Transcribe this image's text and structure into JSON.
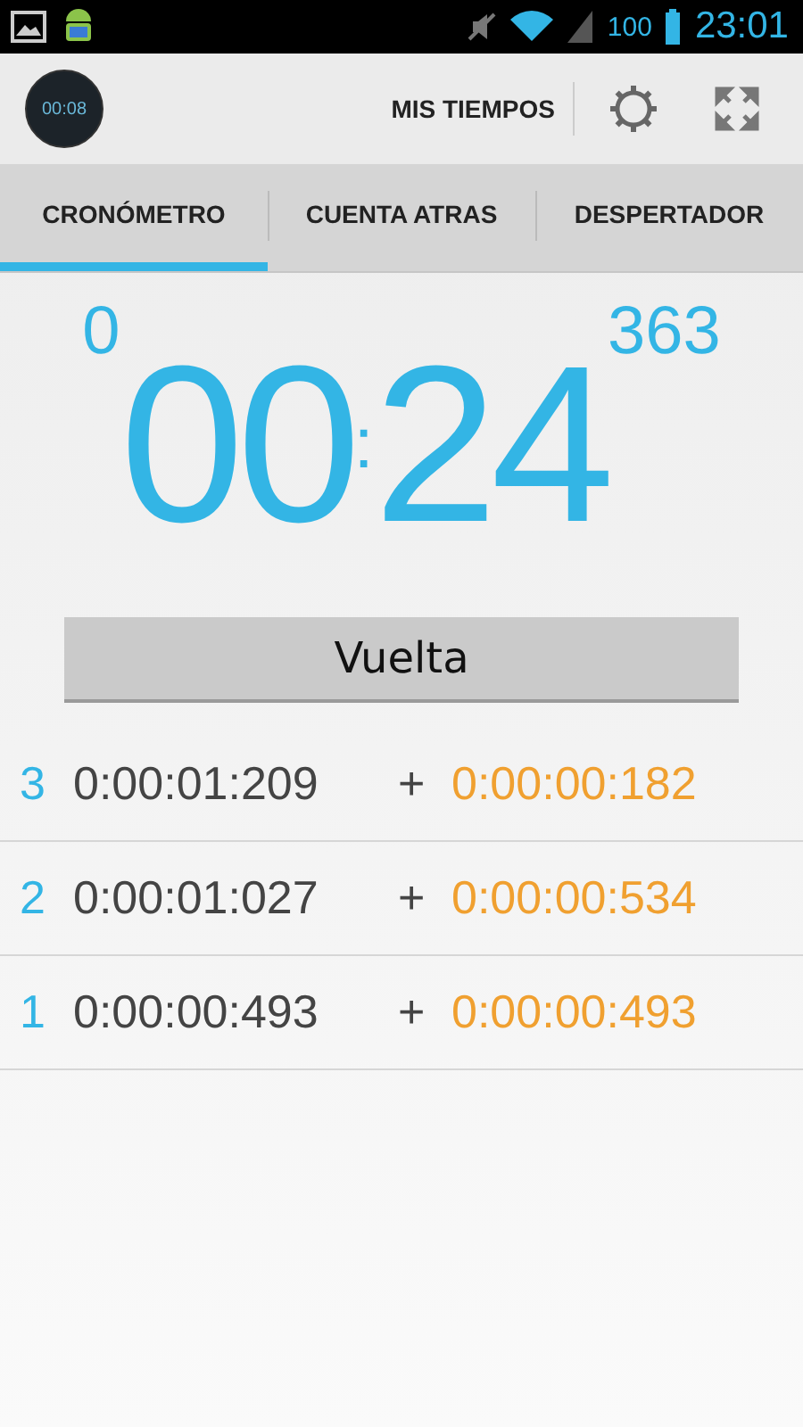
{
  "status_bar": {
    "battery": "100",
    "time": "23:01"
  },
  "action_bar": {
    "logo_text": "00:08",
    "title": "MIS TIEMPOS"
  },
  "tabs": [
    {
      "label": "CRONÓMETRO",
      "selected": true
    },
    {
      "label": "CUENTA ATRAS",
      "selected": false
    },
    {
      "label": "DESPERTADOR",
      "selected": false
    }
  ],
  "clock": {
    "hours": "0",
    "minutes": "00",
    "separator": ":",
    "seconds": "24",
    "milliseconds": "363"
  },
  "lap_button": "Vuelta",
  "laps": [
    {
      "number": "3",
      "total": "0:00:01:209",
      "plus": "+",
      "split": "0:00:00:182"
    },
    {
      "number": "2",
      "total": "0:00:01:027",
      "plus": "+",
      "split": "0:00:00:534"
    },
    {
      "number": "1",
      "total": "0:00:00:493",
      "plus": "+",
      "split": "0:00:00:493"
    }
  ]
}
